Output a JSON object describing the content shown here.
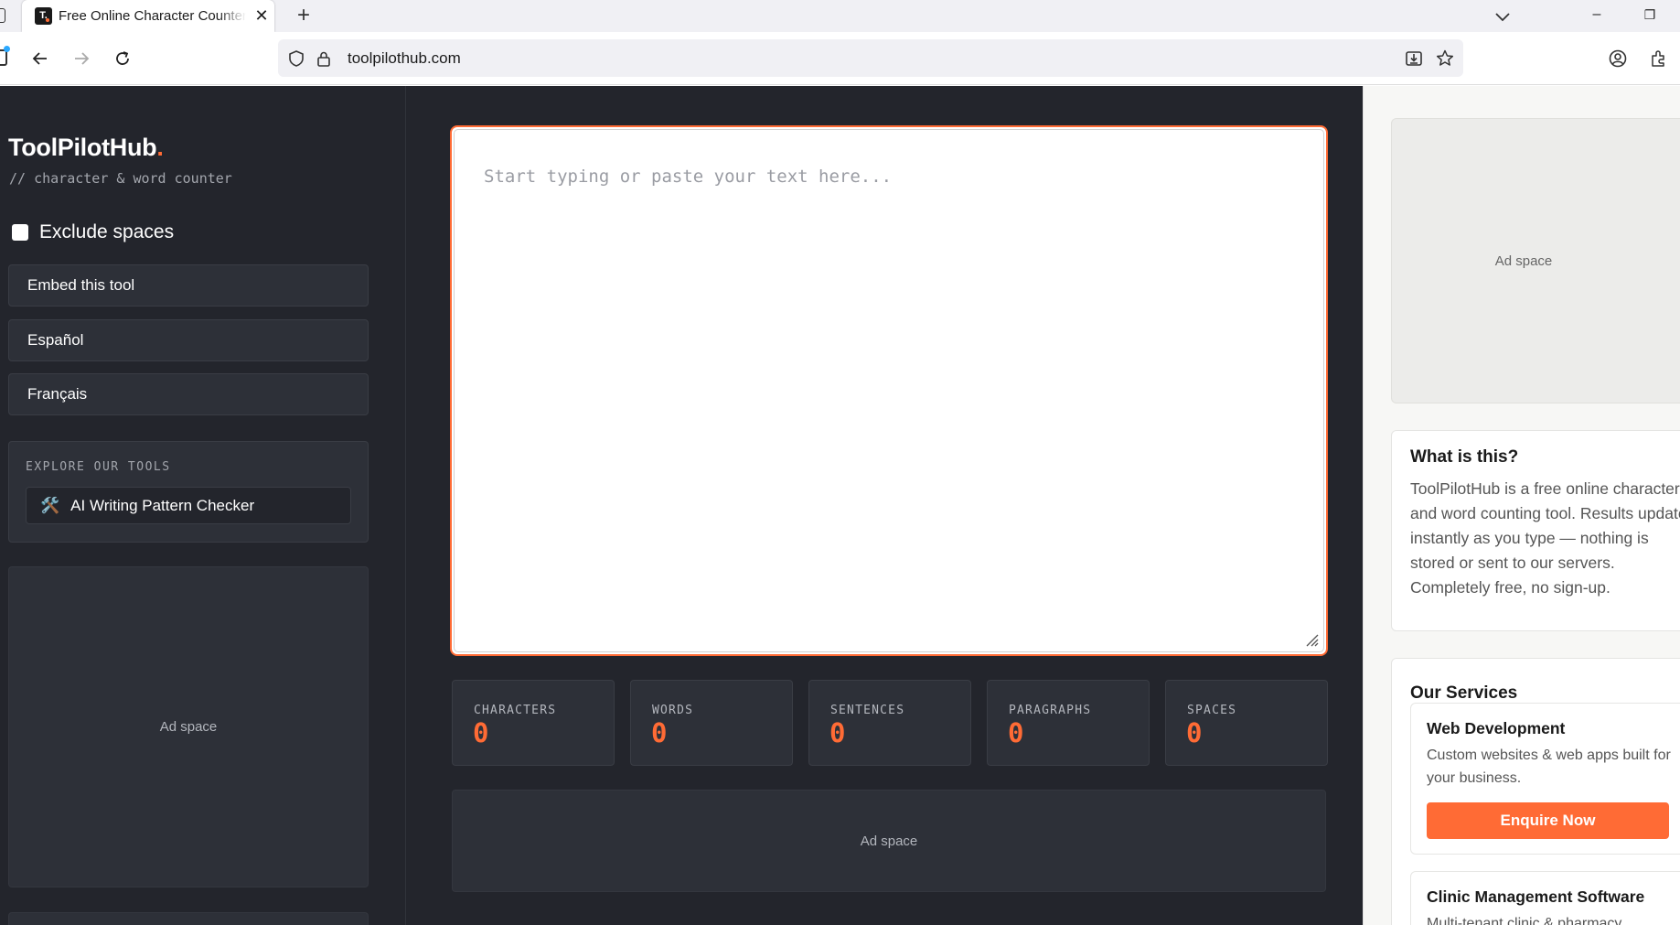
{
  "browser": {
    "tab_title": "Free Online Character Counter & Word Counter",
    "favicon_text": "T.",
    "tab_close": "✕",
    "new_tab": "+",
    "url": "toolpilothub.com",
    "window_minimize": "–",
    "window_restore": "❐"
  },
  "sidebar": {
    "brand": "ToolPilotHub",
    "brand_dot": ".",
    "subtitle": "// character & word counter",
    "exclude_spaces_label": "Exclude spaces",
    "buttons": [
      "Embed this tool",
      "Español",
      "Français"
    ],
    "explore_title": "EXPLORE OUR TOOLS",
    "explore_items": [
      {
        "icon": "🛠️",
        "label": "AI Writing Pattern Checker"
      }
    ],
    "ad_label": "Ad space"
  },
  "main": {
    "editor_placeholder": "Start typing or paste your text here...",
    "stats": [
      {
        "label": "CHARACTERS",
        "value": "0"
      },
      {
        "label": "WORDS",
        "value": "0"
      },
      {
        "label": "SENTENCES",
        "value": "0"
      },
      {
        "label": "PARAGRAPHS",
        "value": "0"
      },
      {
        "label": "SPACES",
        "value": "0"
      }
    ],
    "ad_label": "Ad space"
  },
  "right": {
    "ad_label": "Ad space",
    "info_title": "What is this?",
    "info_text": "ToolPilotHub is a free online character and word counting tool. Results update instantly as you type — nothing is stored or sent to our servers. Completely free, no sign-up.",
    "services_title": "Our Services",
    "services": [
      {
        "name": "Web Development",
        "desc": "Custom websites & web apps built for your business.",
        "cta": "Enquire Now"
      },
      {
        "name": "Clinic Management Software",
        "desc": "Multi-tenant clinic & pharmacy management."
      }
    ]
  },
  "colors": {
    "accent": "#ff6b35",
    "page_bg": "#23252c",
    "card_bg": "#2d3038"
  }
}
